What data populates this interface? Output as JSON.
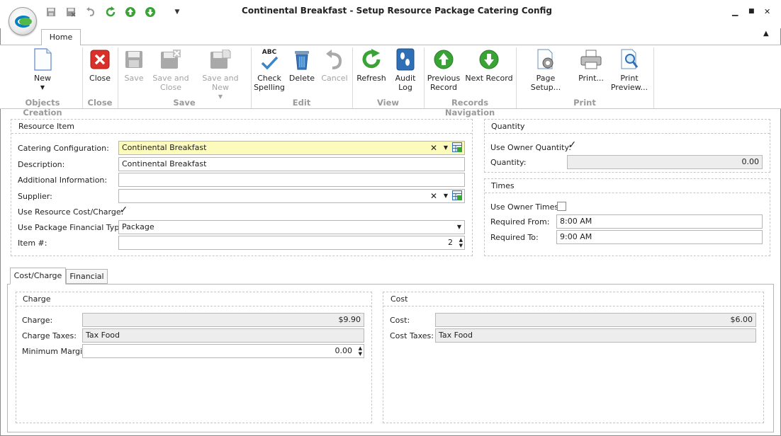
{
  "window": {
    "title": "Continental Breakfast - Setup Resource Package Catering Config",
    "minimize": "▁",
    "maximize": "■",
    "close": "✕"
  },
  "ribbon": {
    "tab_home": "Home",
    "new_label": "New",
    "close_label": "Close",
    "save_label": "Save",
    "save_close_label": "Save and Close",
    "save_new_label": "Save and New",
    "check_spelling_label": "Check Spelling",
    "check_spelling_glyph": "ABC",
    "delete_label": "Delete",
    "cancel_label": "Cancel",
    "refresh_label": "Refresh",
    "audit_log_label": "Audit Log",
    "previous_record_label": "Previous Record",
    "next_record_label": "Next Record",
    "page_setup_label": "Page Setup...",
    "print_label": "Print...",
    "print_preview_label": "Print Preview...",
    "groups": {
      "objects_creation": "Objects Creation",
      "close": "Close",
      "save": "Save",
      "edit": "Edit",
      "view": "View",
      "records_navigation": "Records Navigation",
      "print": "Print"
    }
  },
  "resource_item": {
    "title": "Resource Item",
    "catering_configuration_label": "Catering Configuration:",
    "catering_configuration_value": "Continental Breakfast",
    "description_label": "Description:",
    "description_value": "Continental Breakfast",
    "additional_information_label": "Additional Information:",
    "additional_information_value": "",
    "supplier_label": "Supplier:",
    "supplier_value": "",
    "use_resource_cost_label": "Use Resource Cost/Charge:",
    "use_resource_cost_checked": "✓",
    "use_package_financial_type_label": "Use Package Financial Type:",
    "use_package_financial_type_value": "Package",
    "item_number_label": "Item #:",
    "item_number_value": "2"
  },
  "quantity": {
    "title": "Quantity",
    "use_owner_quantity_label": "Use Owner Quantity:",
    "use_owner_quantity_checked": "✓",
    "quantity_label": "Quantity:",
    "quantity_value": "0.00"
  },
  "times": {
    "title": "Times",
    "use_owner_times_label": "Use Owner Times:",
    "use_owner_times_checked": "",
    "required_from_label": "Required From:",
    "required_from_value": "8:00 AM",
    "required_to_label": "Required To:",
    "required_to_value": "9:00 AM"
  },
  "tabs": {
    "cost_charge": "Cost/Charge",
    "financial": "Financial"
  },
  "charge": {
    "title": "Charge",
    "charge_label": "Charge:",
    "charge_value": "$9.90",
    "charge_taxes_label": "Charge Taxes:",
    "charge_taxes_value": "Tax Food",
    "minimum_margin_label": "Minimum Margin:",
    "minimum_margin_value": "0.00"
  },
  "cost": {
    "title": "Cost",
    "cost_label": "Cost:",
    "cost_value": "$6.00",
    "cost_taxes_label": "Cost Taxes:",
    "cost_taxes_value": "Tax Food"
  },
  "colors": {
    "highlight_field": "#fdfbbc",
    "readonly_field": "#ededed",
    "accent_green": "#3aa335",
    "accent_red": "#d9302a",
    "accent_blue": "#2f6fb5"
  }
}
